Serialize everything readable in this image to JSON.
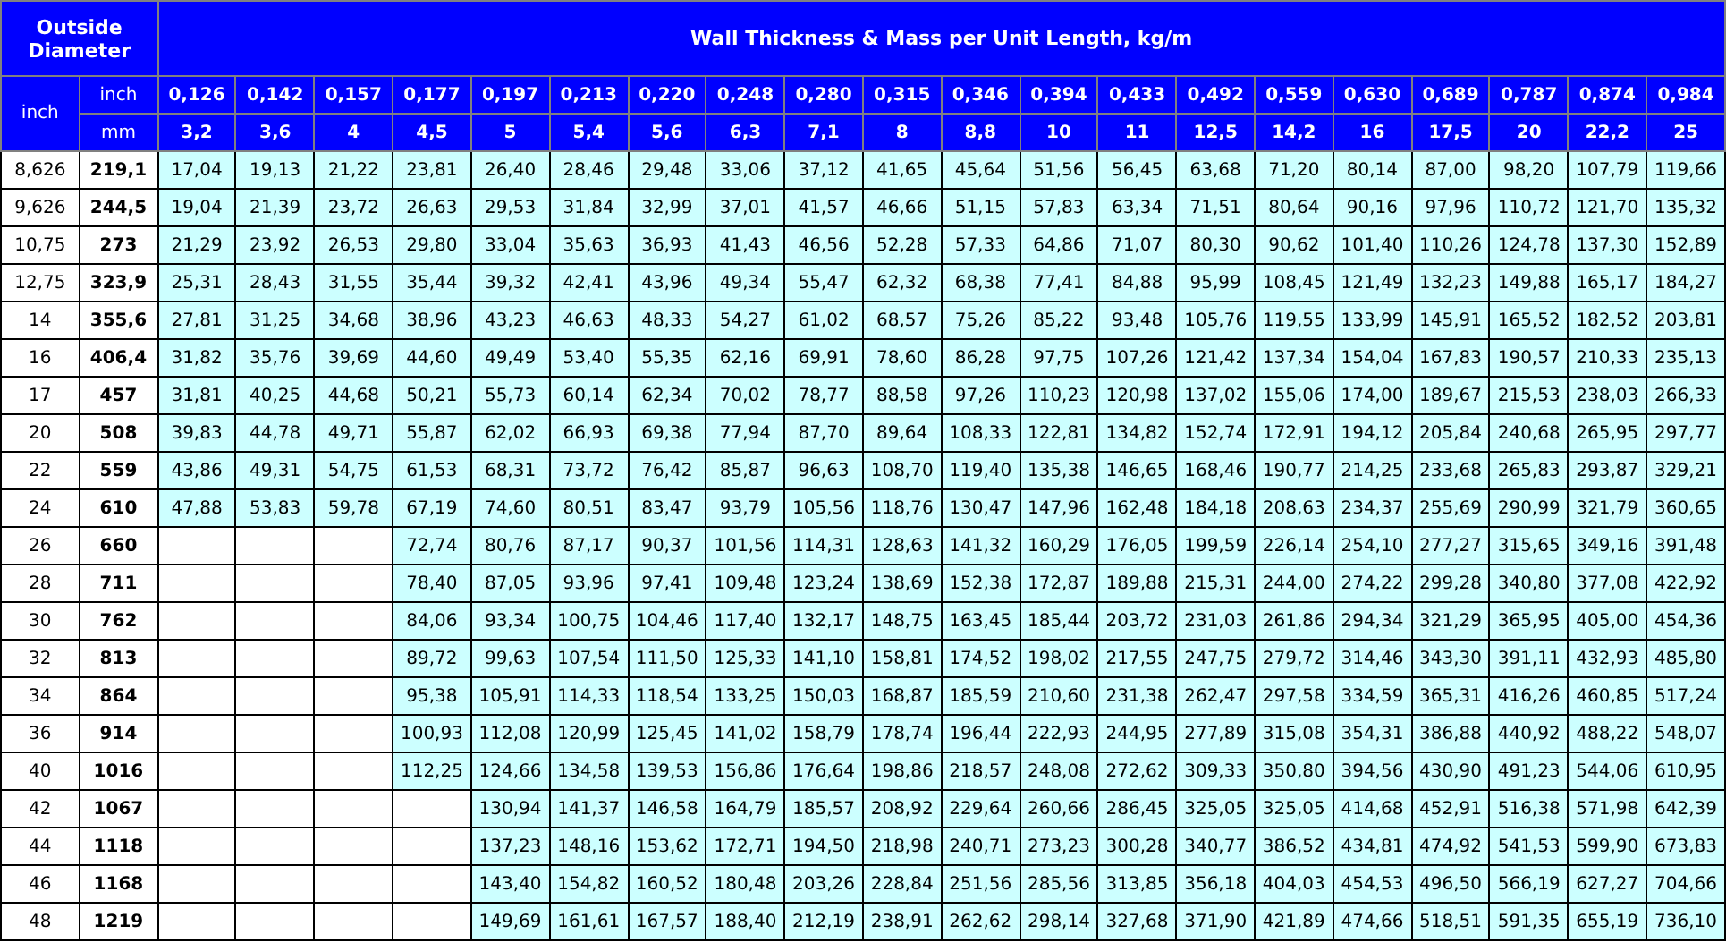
{
  "header": {
    "od_title": "Outside Diameter",
    "title": "Wall Thickness & Mass per Unit Length, kg/m",
    "od_unit": "inch",
    "wall_unit_inch": "inch",
    "wall_unit_mm": "mm"
  },
  "columns": [
    {
      "inch": "0,126",
      "mm": "3,2"
    },
    {
      "inch": "0,142",
      "mm": "3,6"
    },
    {
      "inch": "0,157",
      "mm": "4"
    },
    {
      "inch": "0,177",
      "mm": "4,5"
    },
    {
      "inch": "0,197",
      "mm": "5"
    },
    {
      "inch": "0,213",
      "mm": "5,4"
    },
    {
      "inch": "0,220",
      "mm": "5,6"
    },
    {
      "inch": "0,248",
      "mm": "6,3"
    },
    {
      "inch": "0,280",
      "mm": "7,1"
    },
    {
      "inch": "0,315",
      "mm": "8"
    },
    {
      "inch": "0,346",
      "mm": "8,8"
    },
    {
      "inch": "0,394",
      "mm": "10"
    },
    {
      "inch": "0,433",
      "mm": "11"
    },
    {
      "inch": "0,492",
      "mm": "12,5"
    },
    {
      "inch": "0,559",
      "mm": "14,2"
    },
    {
      "inch": "0,630",
      "mm": "16"
    },
    {
      "inch": "0,689",
      "mm": "17,5"
    },
    {
      "inch": "0,787",
      "mm": "20"
    },
    {
      "inch": "0,874",
      "mm": "22,2"
    },
    {
      "inch": "0,984",
      "mm": "25"
    }
  ],
  "rows": [
    {
      "inch": "8,626",
      "mm": "219,1",
      "values": [
        "17,04",
        "19,13",
        "21,22",
        "23,81",
        "26,40",
        "28,46",
        "29,48",
        "33,06",
        "37,12",
        "41,65",
        "45,64",
        "51,56",
        "56,45",
        "63,68",
        "71,20",
        "80,14",
        "87,00",
        "98,20",
        "107,79",
        "119,66"
      ]
    },
    {
      "inch": "9,626",
      "mm": "244,5",
      "values": [
        "19,04",
        "21,39",
        "23,72",
        "26,63",
        "29,53",
        "31,84",
        "32,99",
        "37,01",
        "41,57",
        "46,66",
        "51,15",
        "57,83",
        "63,34",
        "71,51",
        "80,64",
        "90,16",
        "97,96",
        "110,72",
        "121,70",
        "135,32"
      ]
    },
    {
      "inch": "10,75",
      "mm": "273",
      "values": [
        "21,29",
        "23,92",
        "26,53",
        "29,80",
        "33,04",
        "35,63",
        "36,93",
        "41,43",
        "46,56",
        "52,28",
        "57,33",
        "64,86",
        "71,07",
        "80,30",
        "90,62",
        "101,40",
        "110,26",
        "124,78",
        "137,30",
        "152,89"
      ]
    },
    {
      "inch": "12,75",
      "mm": "323,9",
      "values": [
        "25,31",
        "28,43",
        "31,55",
        "35,44",
        "39,32",
        "42,41",
        "43,96",
        "49,34",
        "55,47",
        "62,32",
        "68,38",
        "77,41",
        "84,88",
        "95,99",
        "108,45",
        "121,49",
        "132,23",
        "149,88",
        "165,17",
        "184,27"
      ]
    },
    {
      "inch": "14",
      "mm": "355,6",
      "values": [
        "27,81",
        "31,25",
        "34,68",
        "38,96",
        "43,23",
        "46,63",
        "48,33",
        "54,27",
        "61,02",
        "68,57",
        "75,26",
        "85,22",
        "93,48",
        "105,76",
        "119,55",
        "133,99",
        "145,91",
        "165,52",
        "182,52",
        "203,81"
      ]
    },
    {
      "inch": "16",
      "mm": "406,4",
      "values": [
        "31,82",
        "35,76",
        "39,69",
        "44,60",
        "49,49",
        "53,40",
        "55,35",
        "62,16",
        "69,91",
        "78,60",
        "86,28",
        "97,75",
        "107,26",
        "121,42",
        "137,34",
        "154,04",
        "167,83",
        "190,57",
        "210,33",
        "235,13"
      ]
    },
    {
      "inch": "17",
      "mm": "457",
      "values": [
        "31,81",
        "40,25",
        "44,68",
        "50,21",
        "55,73",
        "60,14",
        "62,34",
        "70,02",
        "78,77",
        "88,58",
        "97,26",
        "110,23",
        "120,98",
        "137,02",
        "155,06",
        "174,00",
        "189,67",
        "215,53",
        "238,03",
        "266,33"
      ]
    },
    {
      "inch": "20",
      "mm": "508",
      "values": [
        "39,83",
        "44,78",
        "49,71",
        "55,87",
        "62,02",
        "66,93",
        "69,38",
        "77,94",
        "87,70",
        "89,64",
        "108,33",
        "122,81",
        "134,82",
        "152,74",
        "172,91",
        "194,12",
        "205,84",
        "240,68",
        "265,95",
        "297,77"
      ]
    },
    {
      "inch": "22",
      "mm": "559",
      "values": [
        "43,86",
        "49,31",
        "54,75",
        "61,53",
        "68,31",
        "73,72",
        "76,42",
        "85,87",
        "96,63",
        "108,70",
        "119,40",
        "135,38",
        "146,65",
        "168,46",
        "190,77",
        "214,25",
        "233,68",
        "265,83",
        "293,87",
        "329,21"
      ]
    },
    {
      "inch": "24",
      "mm": "610",
      "values": [
        "47,88",
        "53,83",
        "59,78",
        "67,19",
        "74,60",
        "80,51",
        "83,47",
        "93,79",
        "105,56",
        "118,76",
        "130,47",
        "147,96",
        "162,48",
        "184,18",
        "208,63",
        "234,37",
        "255,69",
        "290,99",
        "321,79",
        "360,65"
      ]
    },
    {
      "inch": "26",
      "mm": "660",
      "values": [
        "72,74",
        "80,76",
        "87,17",
        "90,37",
        "101,56",
        "114,31",
        "128,63",
        "141,32",
        "160,29",
        "176,05",
        "199,59",
        "226,14",
        "254,10",
        "277,27",
        "315,65",
        "349,16",
        "391,48"
      ]
    },
    {
      "inch": "28",
      "mm": "711",
      "values": [
        "78,40",
        "87,05",
        "93,96",
        "97,41",
        "109,48",
        "123,24",
        "138,69",
        "152,38",
        "172,87",
        "189,88",
        "215,31",
        "244,00",
        "274,22",
        "299,28",
        "340,80",
        "377,08",
        "422,92"
      ]
    },
    {
      "inch": "30",
      "mm": "762",
      "values": [
        "84,06",
        "93,34",
        "100,75",
        "104,46",
        "117,40",
        "132,17",
        "148,75",
        "163,45",
        "185,44",
        "203,72",
        "231,03",
        "261,86",
        "294,34",
        "321,29",
        "365,95",
        "405,00",
        "454,36"
      ]
    },
    {
      "inch": "32",
      "mm": "813",
      "values": [
        "89,72",
        "99,63",
        "107,54",
        "111,50",
        "125,33",
        "141,10",
        "158,81",
        "174,52",
        "198,02",
        "217,55",
        "247,75",
        "279,72",
        "314,46",
        "343,30",
        "391,11",
        "432,93",
        "485,80"
      ]
    },
    {
      "inch": "34",
      "mm": "864",
      "values": [
        "95,38",
        "105,91",
        "114,33",
        "118,54",
        "133,25",
        "150,03",
        "168,87",
        "185,59",
        "210,60",
        "231,38",
        "262,47",
        "297,58",
        "334,59",
        "365,31",
        "416,26",
        "460,85",
        "517,24"
      ]
    },
    {
      "inch": "36",
      "mm": "914",
      "values": [
        "100,93",
        "112,08",
        "120,99",
        "125,45",
        "141,02",
        "158,79",
        "178,74",
        "196,44",
        "222,93",
        "244,95",
        "277,89",
        "315,08",
        "354,31",
        "386,88",
        "440,92",
        "488,22",
        "548,07"
      ]
    },
    {
      "inch": "40",
      "mm": "1016",
      "values": [
        "112,25",
        "124,66",
        "134,58",
        "139,53",
        "156,86",
        "176,64",
        "198,86",
        "218,57",
        "248,08",
        "272,62",
        "309,33",
        "350,80",
        "394,56",
        "430,90",
        "491,23",
        "544,06",
        "610,95"
      ]
    },
    {
      "inch": "42",
      "mm": "1067",
      "values": [
        "130,94",
        "141,37",
        "146,58",
        "164,79",
        "185,57",
        "208,92",
        "229,64",
        "260,66",
        "286,45",
        "325,05",
        "325,05",
        "414,68",
        "452,91",
        "516,38",
        "571,98",
        "642,39"
      ]
    },
    {
      "inch": "44",
      "mm": "1118",
      "values": [
        "137,23",
        "148,16",
        "153,62",
        "172,71",
        "194,50",
        "218,98",
        "240,71",
        "273,23",
        "300,28",
        "340,77",
        "386,52",
        "434,81",
        "474,92",
        "541,53",
        "599,90",
        "673,83"
      ]
    },
    {
      "inch": "46",
      "mm": "1168",
      "values": [
        "143,40",
        "154,82",
        "160,52",
        "180,48",
        "203,26",
        "228,84",
        "251,56",
        "285,56",
        "313,85",
        "356,18",
        "404,03",
        "454,53",
        "496,50",
        "566,19",
        "627,27",
        "704,66"
      ]
    },
    {
      "inch": "48",
      "mm": "1219",
      "values": [
        "149,69",
        "161,61",
        "167,57",
        "188,40",
        "212,19",
        "238,91",
        "262,62",
        "298,14",
        "327,68",
        "371,90",
        "421,89",
        "474,66",
        "518,51",
        "591,35",
        "655,19",
        "736,10"
      ]
    }
  ]
}
